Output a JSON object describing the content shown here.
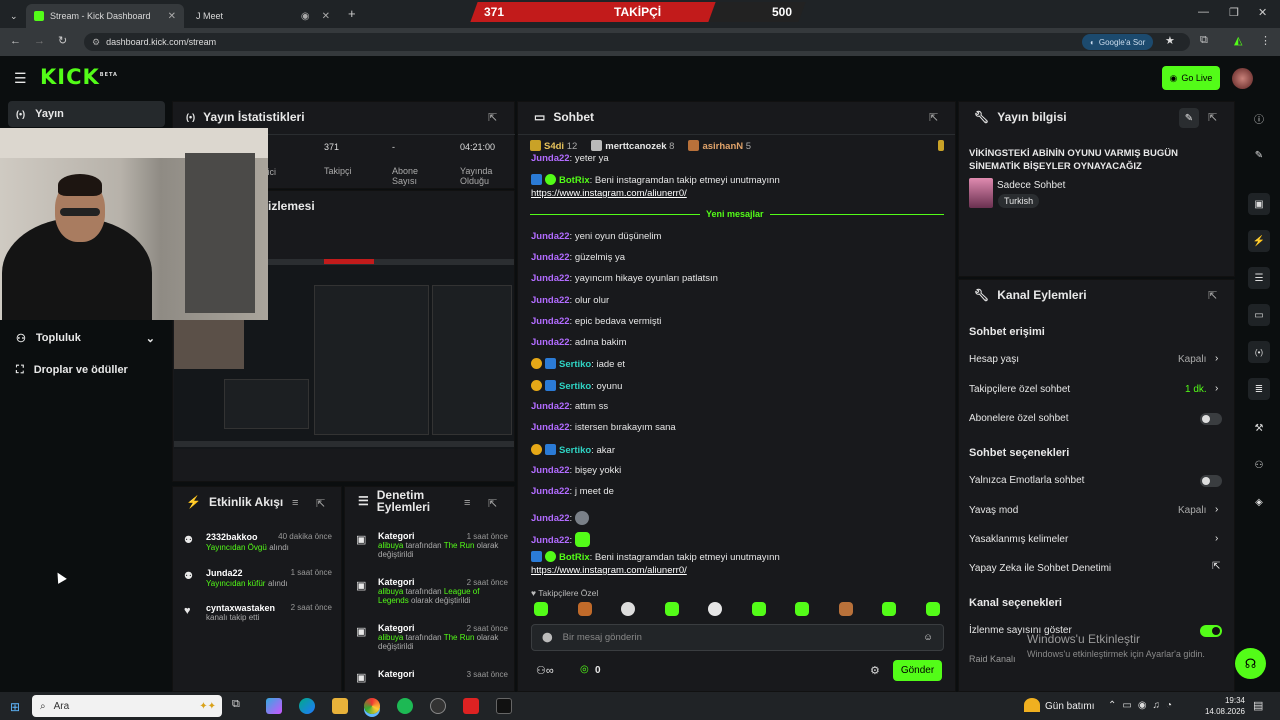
{
  "browser": {
    "tabs": [
      {
        "title": "Stream - Kick Dashboard"
      },
      {
        "title": "J Meet"
      }
    ],
    "url": "dashboard.kick.com/stream",
    "google_label": "Google'a Sor"
  },
  "goal": {
    "current": "371",
    "label": "TAKİPÇİ",
    "target": "500"
  },
  "header": {
    "logo": "KICK",
    "logo_sup": "BETA",
    "go_live": "Go Live"
  },
  "nav": {
    "items": [
      {
        "label": "Yayın"
      },
      {
        "label": "Topluluk"
      },
      {
        "label": "Droplar ve ödüller"
      }
    ]
  },
  "stats": {
    "title": "Yayın İstatistikleri",
    "items": [
      {
        "value": "371",
        "label": "Takipçi"
      },
      {
        "value": "-",
        "label": "Abone Sayısı"
      },
      {
        "value": "04:21:00",
        "label": "Yayında Olduğu"
      }
    ],
    "cut_label": "eyici"
  },
  "preview": {
    "title_fragment": "izlemesi"
  },
  "activity": {
    "title": "Etkinlik Akışı",
    "items": [
      {
        "name": "2332bakkoo",
        "time": "40 dakika önce",
        "type": "Yayıncıdan Övgü",
        "suffix": "alındı"
      },
      {
        "name": "Junda22",
        "time": "1 saat önce",
        "type": "Yayıncıdan küfür",
        "suffix": "alındı"
      },
      {
        "name": "cyntaxwastaken",
        "time": "2 saat önce",
        "type": "kanalı takip etti",
        "suffix": ""
      }
    ]
  },
  "moderation": {
    "title": "Denetim Eylemleri",
    "items": [
      {
        "title": "Kategori",
        "time": "1 saat önce",
        "user": "alibuya",
        "mid": "tarafından",
        "value": "The Run",
        "tail": "olarak değiştirildi"
      },
      {
        "title": "Kategori",
        "time": "2 saat önce",
        "user": "alibuya",
        "mid": "tarafından",
        "value": "League of Legends",
        "tail": "olarak değiştirildi"
      },
      {
        "title": "Kategori",
        "time": "2 saat önce",
        "user": "alibuya",
        "mid": "tarafından",
        "value": "The Run",
        "tail": "olarak değiştirildi"
      },
      {
        "title": "Kategori",
        "time": "3 saat önce",
        "user": "",
        "mid": "",
        "value": "",
        "tail": ""
      }
    ]
  },
  "chat": {
    "title": "Sohbet",
    "top_chatters": [
      {
        "name": "S4di",
        "count": "12"
      },
      {
        "name": "merttcanozek",
        "count": "8"
      },
      {
        "name": "asirhanN",
        "count": "5"
      }
    ],
    "new_messages": "Yeni mesajlar",
    "messages": [
      {
        "user": "Junda22",
        "text": "yeter ya",
        "color": "purple"
      },
      {
        "user": "BotRix",
        "text": "Beni instagramdan takip etmeyi unutmayınn",
        "color": "green",
        "link": "https://www.instagram.com/aliunerr0/"
      },
      {
        "user": "Junda22",
        "text": "yeni oyun düşünelim",
        "color": "purple"
      },
      {
        "user": "Junda22",
        "text": "güzelmiş ya",
        "color": "purple"
      },
      {
        "user": "Junda22",
        "text": "yayıncım hikaye oyunları patlatsın",
        "color": "purple"
      },
      {
        "user": "Junda22",
        "text": "olur olur",
        "color": "purple"
      },
      {
        "user": "Junda22",
        "text": "epic bedava vermişti",
        "color": "purple"
      },
      {
        "user": "Junda22",
        "text": "adına bakim",
        "color": "purple"
      },
      {
        "user": "Sertiko",
        "text": "iade et",
        "color": "teal"
      },
      {
        "user": "Sertiko",
        "text": "oyunu",
        "color": "teal"
      },
      {
        "user": "Junda22",
        "text": "attım ss",
        "color": "purple"
      },
      {
        "user": "Junda22",
        "text": "istersen bırakayım sana",
        "color": "purple"
      },
      {
        "user": "Sertiko",
        "text": "akar",
        "color": "teal"
      },
      {
        "user": "Junda22",
        "text": "bişey yokki",
        "color": "purple"
      },
      {
        "user": "Junda22",
        "text": "j meet de",
        "color": "purple"
      },
      {
        "user": "Junda22",
        "text": "",
        "color": "purple"
      },
      {
        "user": "Junda22",
        "text": "",
        "color": "purple"
      },
      {
        "user": "BotRix",
        "text": "Beni instagramdan takip etmeyi unutmayınn",
        "color": "green",
        "link": "https://www.instagram.com/aliunerr0/"
      }
    ],
    "followers_only": "Takipçilere Özel",
    "input_placeholder": "Bir mesaj gönderin",
    "count": "0",
    "send": "Gönder"
  },
  "stream_info": {
    "title": "Yayın bilgisi",
    "stream_title": "VİKİNGSTEKİ ABİNİN OYUNU VARMIŞ BUGÜN SİNEMATİK BİŞEYLER OYNAYACAĞIZ",
    "category": "Sadece Sohbet",
    "language": "Turkish"
  },
  "channel_actions": {
    "title": "Kanal Eylemleri",
    "chat_access": "Sohbet erişimi",
    "account_age": {
      "label": "Hesap yaşı",
      "value": "Kapalı"
    },
    "followers_chat": {
      "label": "Takipçilere özel sohbet",
      "value": "1 dk."
    },
    "subs_chat": {
      "label": "Abonelere özel sohbet"
    },
    "chat_options": "Sohbet seçenekleri",
    "emote_only": {
      "label": "Yalnızca Emotlarla sohbet"
    },
    "slow_mode": {
      "label": "Yavaş mod",
      "value": "Kapalı"
    },
    "banned_words": {
      "label": "Yasaklanmış kelimeler"
    },
    "ai_mod": {
      "label": "Yapay Zeka ile Sohbet Denetimi"
    },
    "channel_options": "Kanal seçenekleri",
    "show_viewers": {
      "label": "İzlenme sayısını göster"
    },
    "raid": {
      "label": "Raid Kanalı"
    }
  },
  "watermark": {
    "line1": "Windows'u Etkinleştir",
    "line2": "Windows'u etkinleştirmek için Ayarlar'a gidin."
  },
  "taskbar": {
    "search": "Ara",
    "weather": "Gün batımı",
    "time": "19:34",
    "date": "14.08.2026"
  },
  "colors": {
    "accent": "#53fc18",
    "goal_red": "#c21b1b",
    "bg": "#0b0e0f",
    "panel": "#18191c"
  }
}
